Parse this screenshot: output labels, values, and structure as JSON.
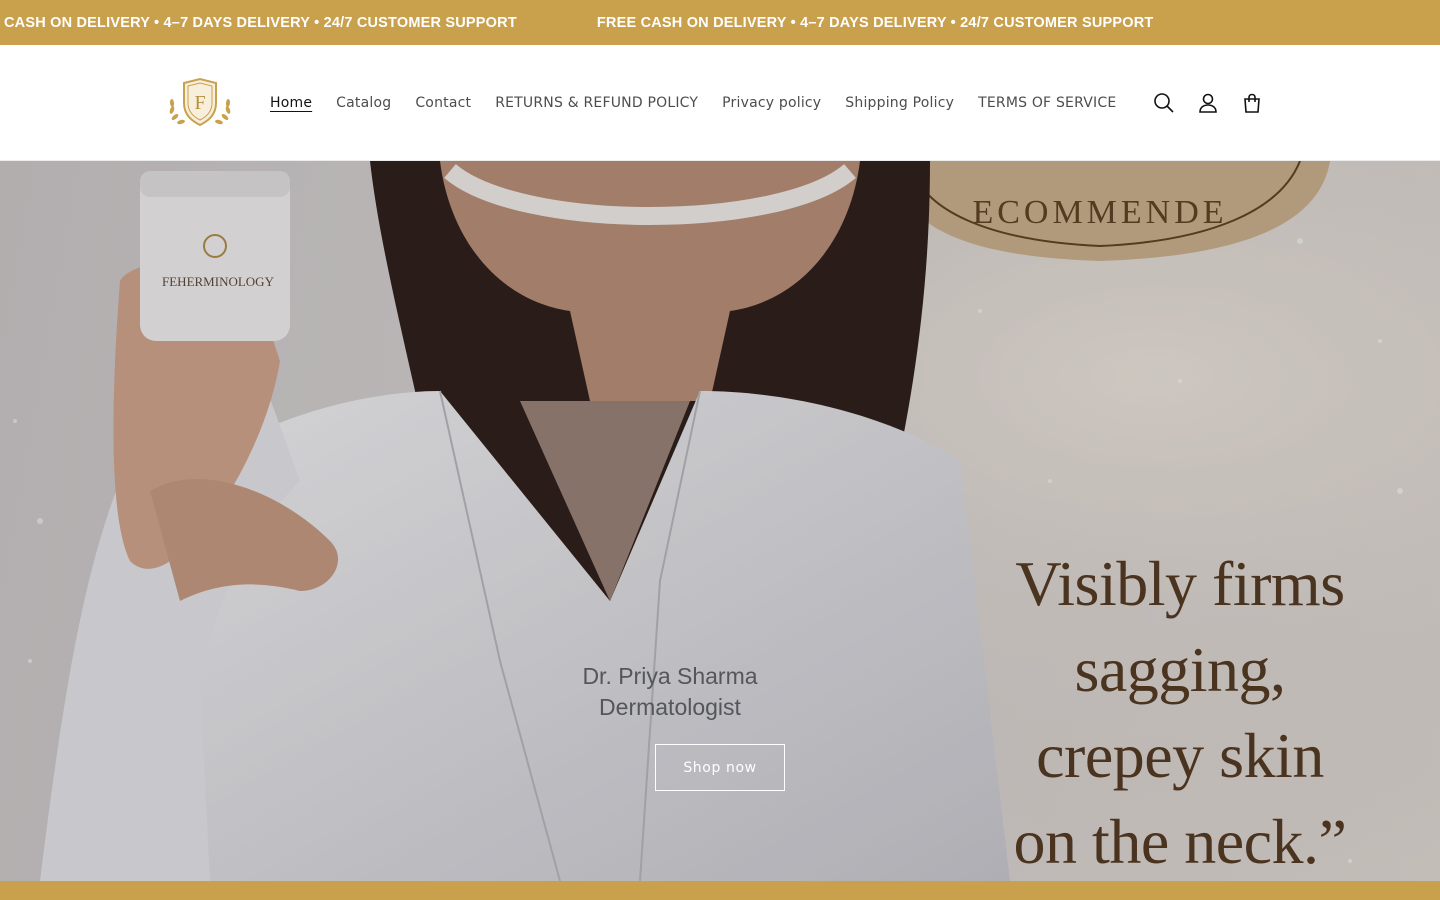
{
  "announcement": {
    "items": [
      "CASH ON DELIVERY • 4–7 DAYS DELIVERY • 24/7 CUSTOMER SUPPORT",
      "FREE CASH ON DELIVERY • 4–7 DAYS DELIVERY • 24/7 CUSTOMER SUPPORT"
    ],
    "background": "#c9a04c"
  },
  "header": {
    "logo_icon": "crest-f-logo-icon",
    "nav": [
      {
        "label": "Home",
        "active": true
      },
      {
        "label": "Catalog"
      },
      {
        "label": "Contact"
      },
      {
        "label": "RETURNS & REFUND POLICY"
      },
      {
        "label": "Privacy policy"
      },
      {
        "label": "Shipping Policy"
      },
      {
        "label": "TERMS OF SERVICE"
      }
    ],
    "icons": [
      "search-icon",
      "account-icon",
      "cart-icon"
    ]
  },
  "hero": {
    "badge_text": "ECOMMENDE",
    "jar_label": "FEHERMINOLOGY",
    "coat_name": "Dr. Priya Sharma",
    "coat_title": "Dermatologist",
    "quote_lines": [
      "Visibly firms",
      "sagging,",
      "crepey skin",
      "on the neck.”"
    ],
    "button_label": "Shop now"
  },
  "colors": {
    "accent_gold": "#c9a04c",
    "quote_brown": "#4a3420"
  }
}
